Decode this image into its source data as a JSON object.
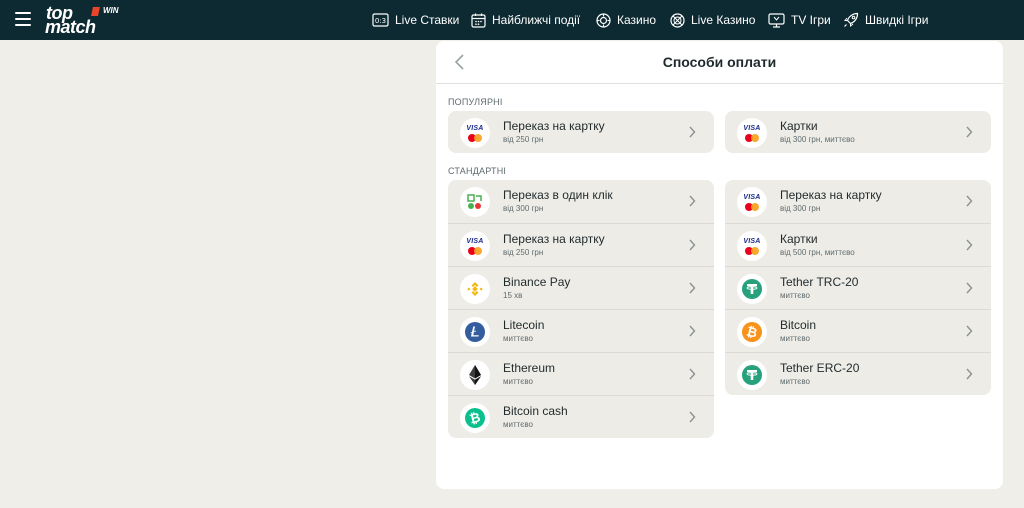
{
  "brand": {
    "logo_top": "top",
    "logo_bottom": "match",
    "logo_win": "WIN"
  },
  "nav": [
    {
      "label": "Live Ставки",
      "icon": "scoreboard-icon"
    },
    {
      "label": "Найближчі події",
      "icon": "calendar-icon"
    },
    {
      "label": "Казино",
      "icon": "casino-chip-icon"
    },
    {
      "label": "Live Казино",
      "icon": "live-casino-icon"
    },
    {
      "label": "TV Ігри",
      "icon": "tv-icon"
    },
    {
      "label": "Швидкі Ігри",
      "icon": "rocket-icon"
    }
  ],
  "panel": {
    "title": "Способи оплати"
  },
  "sections": {
    "popular": "Популярні",
    "standard": "Стандартні"
  },
  "popular": [
    {
      "name": "Переказ на картку",
      "sub": "від 250 грн",
      "icon": "visa-mastercard-icon"
    },
    {
      "name": "Картки",
      "sub": "від 300 грн, миттєво",
      "icon": "visa-mastercard-icon"
    }
  ],
  "standard_left": [
    {
      "name": "Переказ в один клік",
      "sub": "від 300 грн",
      "icon": "one-click-icon"
    },
    {
      "name": "Переказ на картку",
      "sub": "від 250 грн",
      "icon": "visa-mastercard-icon"
    },
    {
      "name": "Binance Pay",
      "sub": "15 хв",
      "icon": "binance-icon"
    },
    {
      "name": "Litecoin",
      "sub": "миттєво",
      "icon": "litecoin-icon"
    },
    {
      "name": "Ethereum",
      "sub": "миттєво",
      "icon": "ethereum-icon"
    },
    {
      "name": "Bitcoin cash",
      "sub": "миттєво",
      "icon": "bitcoin-cash-icon"
    }
  ],
  "standard_right": [
    {
      "name": "Переказ на картку",
      "sub": "від 300 грн",
      "icon": "visa-mastercard-icon"
    },
    {
      "name": "Картки",
      "sub": "від 500 грн, миттєво",
      "icon": "visa-mastercard-icon"
    },
    {
      "name": "Tether TRC-20",
      "sub": "миттєво",
      "icon": "tether-icon"
    },
    {
      "name": "Bitcoin",
      "sub": "миттєво",
      "icon": "bitcoin-icon"
    },
    {
      "name": "Tether ERC-20",
      "sub": "миттєво",
      "icon": "tether-icon"
    }
  ],
  "icon_text": {
    "visa": "VISA"
  },
  "colors": {
    "header": "#0d2a32",
    "page_bg": "#f0eee8",
    "card_bg": "#eeece7",
    "binance": "#f0b90b",
    "litecoin": "#345d9d",
    "bitcoin_cash": "#0ac18e",
    "tether": "#26a17b",
    "bitcoin": "#f7931a",
    "ethereum": "#3c3c3d"
  }
}
